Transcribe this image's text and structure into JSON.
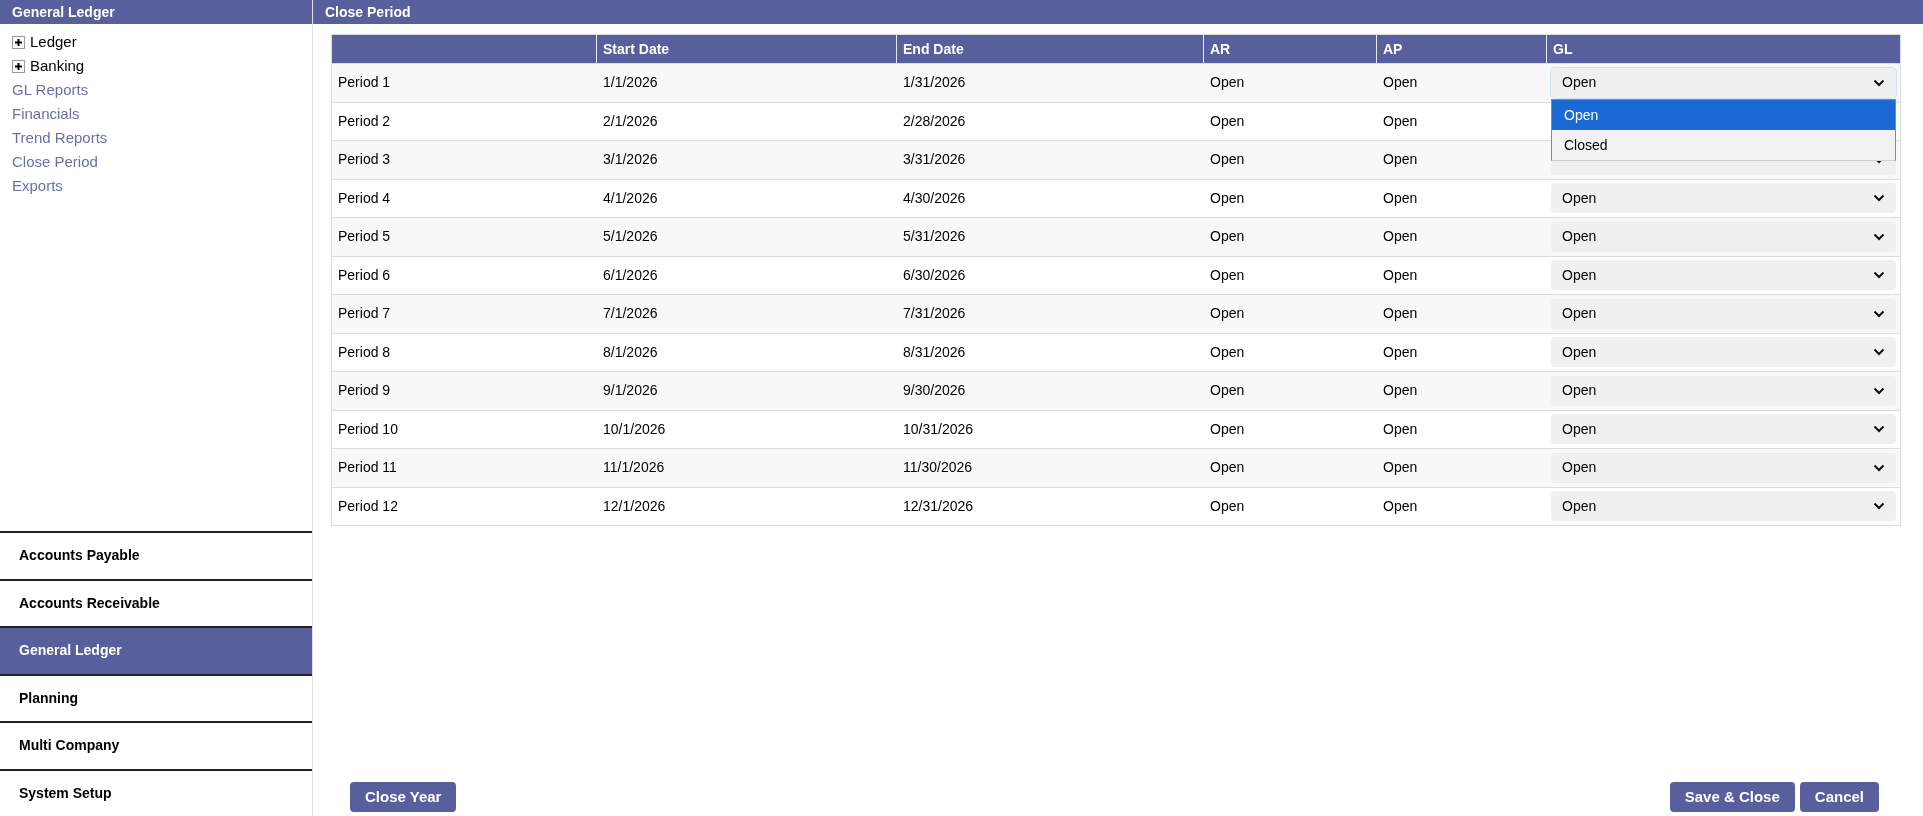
{
  "sidebar": {
    "title": "General Ledger",
    "tree": [
      {
        "label": "Ledger",
        "expanded": false
      },
      {
        "label": "Banking",
        "expanded": false
      }
    ],
    "links": [
      "GL Reports",
      "Financials",
      "Trend Reports",
      "Close Period",
      "Exports"
    ],
    "modules": [
      {
        "label": "Accounts Payable",
        "selected": false
      },
      {
        "label": "Accounts Receivable",
        "selected": false
      },
      {
        "label": "General Ledger",
        "selected": true
      },
      {
        "label": "Planning",
        "selected": false
      },
      {
        "label": "Multi Company",
        "selected": false
      },
      {
        "label": "System Setup",
        "selected": false
      }
    ]
  },
  "main": {
    "title": "Close Period",
    "table": {
      "columns": [
        "Start Date",
        "End Date",
        "AR",
        "AP",
        "GL"
      ],
      "rows": [
        {
          "period": "Period 1",
          "start": "1/1/2026",
          "end": "1/31/2026",
          "ar": "Open",
          "ap": "Open",
          "gl": {
            "value": "Open",
            "expanded": true,
            "options": [
              {
                "label": "Open",
                "selected": true
              },
              {
                "label": "Closed",
                "selected": false
              }
            ]
          }
        },
        {
          "period": "Period 2",
          "start": "2/1/2026",
          "end": "2/28/2026",
          "ar": "Open",
          "ap": "Open"
        },
        {
          "period": "Period 3",
          "start": "3/1/2026",
          "end": "3/31/2026",
          "ar": "Open",
          "ap": "Open",
          "gl": {
            "expanded": false
          }
        },
        {
          "period": "Period 4",
          "start": "4/1/2026",
          "end": "4/30/2026",
          "ar": "Open",
          "ap": "Open",
          "gl": {
            "value": "Open",
            "expanded": false
          }
        },
        {
          "period": "Period 5",
          "start": "5/1/2026",
          "end": "5/31/2026",
          "ar": "Open",
          "ap": "Open",
          "gl": {
            "value": "Open",
            "expanded": false
          }
        },
        {
          "period": "Period 6",
          "start": "6/1/2026",
          "end": "6/30/2026",
          "ar": "Open",
          "ap": "Open",
          "gl": {
            "value": "Open",
            "expanded": false
          }
        },
        {
          "period": "Period 7",
          "start": "7/1/2026",
          "end": "7/31/2026",
          "ar": "Open",
          "ap": "Open",
          "gl": {
            "value": "Open",
            "expanded": false
          }
        },
        {
          "period": "Period 8",
          "start": "8/1/2026",
          "end": "8/31/2026",
          "ar": "Open",
          "ap": "Open",
          "gl": {
            "value": "Open",
            "expanded": false
          }
        },
        {
          "period": "Period 9",
          "start": "9/1/2026",
          "end": "9/30/2026",
          "ar": "Open",
          "ap": "Open",
          "gl": {
            "value": "Open",
            "expanded": false
          }
        },
        {
          "period": "Period 10",
          "start": "10/1/2026",
          "end": "10/31/2026",
          "ar": "Open",
          "ap": "Open",
          "gl": {
            "value": "Open",
            "expanded": false
          }
        },
        {
          "period": "Period 11",
          "start": "11/1/2026",
          "end": "11/30/2026",
          "ar": "Open",
          "ap": "Open",
          "gl": {
            "value": "Open",
            "expanded": false
          }
        },
        {
          "period": "Period 12",
          "start": "12/1/2026",
          "end": "12/31/2026",
          "ar": "Open",
          "ap": "Open",
          "gl": {
            "value": "Open",
            "expanded": false
          }
        }
      ]
    },
    "buttons": {
      "left": [
        "Close Year"
      ],
      "right": [
        "Save & Close",
        "Cancel"
      ]
    }
  }
}
